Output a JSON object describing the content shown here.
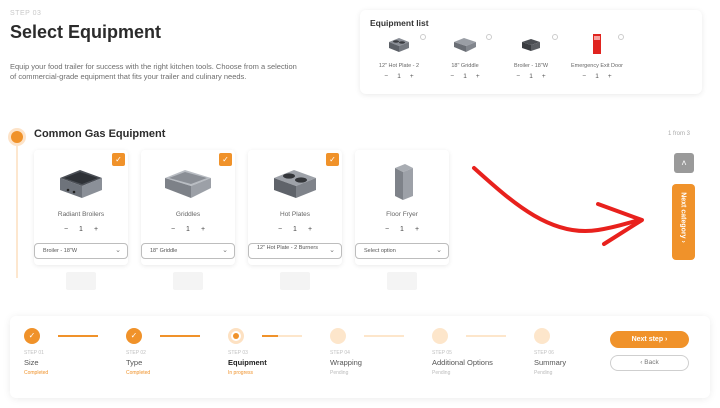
{
  "header": {
    "step_kicker": "STEP 03",
    "title": "Select Equipment",
    "intro": "Equip your food trailer for success with the right kitchen tools. Choose from a selection of commercial-grade equipment that fits your trailer and culinary needs."
  },
  "equipment_list": {
    "title": "Equipment list",
    "items": [
      {
        "name": "12\" Hot Plate - 2",
        "qty": "1",
        "minus": "−",
        "plus": "+",
        "icon": "hot-plate-icon"
      },
      {
        "name": "18\" Griddle",
        "qty": "1",
        "minus": "−",
        "plus": "+",
        "icon": "griddle-icon"
      },
      {
        "name": "Broiler - 18\"W",
        "qty": "1",
        "minus": "−",
        "plus": "+",
        "icon": "broiler-icon"
      },
      {
        "name": "Emergency Exit Door",
        "qty": "1",
        "minus": "−",
        "plus": "+",
        "icon": "door-icon"
      }
    ]
  },
  "section": {
    "title": "Common Gas Equipment",
    "pager": "1 from 3"
  },
  "cards": [
    {
      "name": "Radiant Broilers",
      "qty": "1",
      "minus": "−",
      "plus": "+",
      "select": "Broiler - 18\"W",
      "checked": true,
      "icon": "broiler-icon"
    },
    {
      "name": "Griddles",
      "qty": "1",
      "minus": "−",
      "plus": "+",
      "select": "18\" Griddle",
      "checked": true,
      "icon": "griddle-icon"
    },
    {
      "name": "Hot Plates",
      "qty": "1",
      "minus": "−",
      "plus": "+",
      "select": "12\" Hot Plate - 2 Burners",
      "checked": true,
      "icon": "hot-plate-icon"
    },
    {
      "name": "Floor Fryer",
      "qty": "1",
      "minus": "−",
      "plus": "+",
      "select": "Select option",
      "checked": false,
      "icon": "fryer-icon"
    }
  ],
  "nav": {
    "up": "˄",
    "next_category": "Next category ›"
  },
  "stepper": {
    "steps": [
      {
        "kicker": "STEP 01",
        "label": "Size",
        "status": "Completed",
        "state": "done"
      },
      {
        "kicker": "STEP 02",
        "label": "Type",
        "status": "Completed",
        "state": "done"
      },
      {
        "kicker": "STEP 03",
        "label": "Equipment",
        "status": "In progress",
        "state": "current"
      },
      {
        "kicker": "STEP 04",
        "label": "Wrapping",
        "status": "Pending",
        "state": "pending"
      },
      {
        "kicker": "STEP 05",
        "label": "Additional Options",
        "status": "Pending",
        "state": "pending"
      },
      {
        "kicker": "STEP 06",
        "label": "Summary",
        "status": "Pending",
        "state": "pending"
      }
    ],
    "next_step": "Next step ›",
    "back": "‹ Back"
  },
  "glyphs": {
    "check": "✓",
    "chevron": "⌄"
  },
  "colors": {
    "accent": "#f0922a",
    "arrow": "#e8211d"
  }
}
